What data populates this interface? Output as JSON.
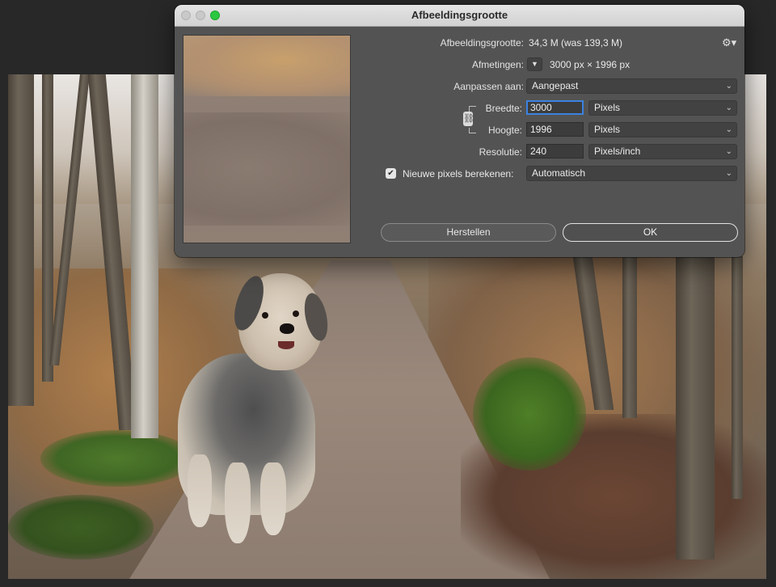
{
  "dialog": {
    "title": "Afbeeldingsgrootte",
    "image_size_label": "Afbeeldingsgrootte:",
    "image_size_value": "34,3 M (was 139,3 M)",
    "dimensions_label": "Afmetingen:",
    "dimensions_value": "3000 px  ×  1996 px",
    "fit_to_label": "Aanpassen aan:",
    "fit_to_value": "Aangepast",
    "width_label": "Breedte:",
    "width_value": "3000",
    "width_unit": "Pixels",
    "height_label": "Hoogte:",
    "height_value": "1996",
    "height_unit": "Pixels",
    "resolution_label": "Resolutie:",
    "resolution_value": "240",
    "resolution_unit": "Pixels/inch",
    "resample_label": "Nieuwe pixels berekenen:",
    "resample_checked": true,
    "resample_value": "Automatisch",
    "reset_button": "Herstellen",
    "ok_button": "OK",
    "constrain_proportions_linked": true
  },
  "icons": {
    "gear": "gear-icon",
    "chain": "link-icon",
    "chevron": "chevron-down-icon",
    "check": "checkmark-icon"
  },
  "colors": {
    "dialog_bg": "#535353",
    "titlebar_bg": "#d8d8d8",
    "focus_ring": "#3b82e0",
    "zoom_button": "#2ac840"
  }
}
